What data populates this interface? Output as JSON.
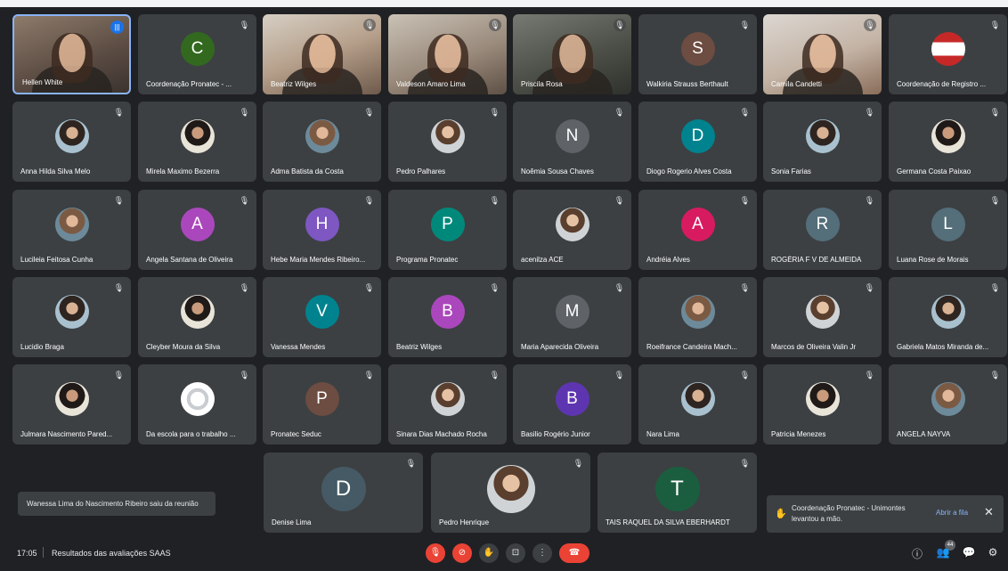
{
  "tiles": [
    {
      "name": "Hellen White",
      "kind": "video",
      "speaking": true
    },
    {
      "name": "Coordenação Pronatec - ...",
      "letter": "C",
      "color": "#33691e"
    },
    {
      "name": "Beatriz Wilges",
      "kind": "video"
    },
    {
      "name": "Valdeson Amaro Lima",
      "kind": "video"
    },
    {
      "name": "Priscila Rosa",
      "kind": "video"
    },
    {
      "name": "Walkiria Strauss Berthault",
      "letter": "S",
      "color": "#6d4c41"
    },
    {
      "name": "Camila Candetti",
      "kind": "video"
    },
    {
      "name": "Coordenação de Registro ...",
      "kind": "photo"
    },
    {
      "name": "Anna Hilda Silva Melo",
      "kind": "photo"
    },
    {
      "name": "Mirela Maximo Bezerra",
      "kind": "photo"
    },
    {
      "name": "Adma Batista da Costa",
      "kind": "photo"
    },
    {
      "name": "Pedro Palhares",
      "kind": "photo"
    },
    {
      "name": "Noêmia Sousa Chaves",
      "letter": "N",
      "color": "#5f6368"
    },
    {
      "name": "Diogo Rogerio Alves Costa",
      "letter": "D",
      "color": "#00838f"
    },
    {
      "name": "Sonia Farias",
      "kind": "photo"
    },
    {
      "name": "Germana Costa Paixao",
      "kind": "photo"
    },
    {
      "name": "Lucileia Feitosa Cunha",
      "kind": "photo"
    },
    {
      "name": "Angela Santana de Oliveira",
      "letter": "A",
      "color": "#ab47bc"
    },
    {
      "name": "Hebe Maria Mendes Ribeiro...",
      "letter": "H",
      "color": "#7e57c2"
    },
    {
      "name": "Programa Pronatec",
      "letter": "P",
      "color": "#00897b"
    },
    {
      "name": "acenilza ACE",
      "kind": "photo"
    },
    {
      "name": "Andréia Alves",
      "letter": "A",
      "color": "#d81b60"
    },
    {
      "name": "ROGÉRIA F V DE ALMEIDA",
      "letter": "R",
      "color": "#546e7a"
    },
    {
      "name": "Luana Rose de Morais",
      "letter": "L",
      "color": "#546e7a"
    },
    {
      "name": "Lucidio Braga",
      "kind": "photo"
    },
    {
      "name": "Cleyber Moura da Silva",
      "kind": "photo"
    },
    {
      "name": "Vanessa Mendes",
      "letter": "V",
      "color": "#00838f"
    },
    {
      "name": "Beatriz Wilges",
      "letter": "B",
      "color": "#ab47bc"
    },
    {
      "name": "Maria Aparecida Oliveira",
      "letter": "M",
      "color": "#5f6368"
    },
    {
      "name": "Roeifrance Candeira Mach...",
      "kind": "photo"
    },
    {
      "name": "Marcos de Oliveira Valin Jr",
      "kind": "photo"
    },
    {
      "name": "Gabriela Matos Miranda de...",
      "kind": "photo"
    },
    {
      "name": "Julmara Nascimento Pared...",
      "kind": "photo"
    },
    {
      "name": "Da escola para o trabalho ...",
      "kind": "photo"
    },
    {
      "name": "Pronatec Seduc",
      "letter": "P",
      "color": "#6d4c41"
    },
    {
      "name": "Sinara Dias Machado Rocha",
      "kind": "photo"
    },
    {
      "name": "Basilio Rogério Junior",
      "letter": "B",
      "color": "#5e35b1"
    },
    {
      "name": "Nara Lima",
      "kind": "photo"
    },
    {
      "name": "Patricia Menezes",
      "kind": "photo"
    },
    {
      "name": "ANGELA NAYVA",
      "kind": "photo"
    }
  ],
  "bottom_tiles": [
    {
      "name": "Denise Lima",
      "letter": "D",
      "color": "#455a64"
    },
    {
      "name": "Pedro Henrique",
      "kind": "photo"
    },
    {
      "name": "TAIS RAQUEL DA SILVA EBERHARDT",
      "letter": "T",
      "color": "#1b5e3f"
    }
  ],
  "toasts": {
    "left": "Wanessa Lima do Nascimento Ribeiro saiu da reunião",
    "right_message": "Coordenação Pronatec - Unimontes levantou a mão.",
    "right_action": "Abrir a fila",
    "close_glyph": "✕",
    "hand_glyph": "✋"
  },
  "bottombar": {
    "time": "17:05",
    "title": "Resultados das avaliações SAAS",
    "participant_count": "44",
    "controls": {
      "mic_glyph": "🎙",
      "cam_glyph": "⊘",
      "hand_glyph": "✋",
      "present_glyph": "⊡",
      "more_glyph": "⋮",
      "end_glyph": "☎",
      "info_glyph": "ⓘ",
      "people_glyph": "👥",
      "chat_glyph": "💬",
      "activities_glyph": "⚙"
    }
  },
  "mic_off_glyph": "🎙",
  "speaking_glyph": "|||"
}
